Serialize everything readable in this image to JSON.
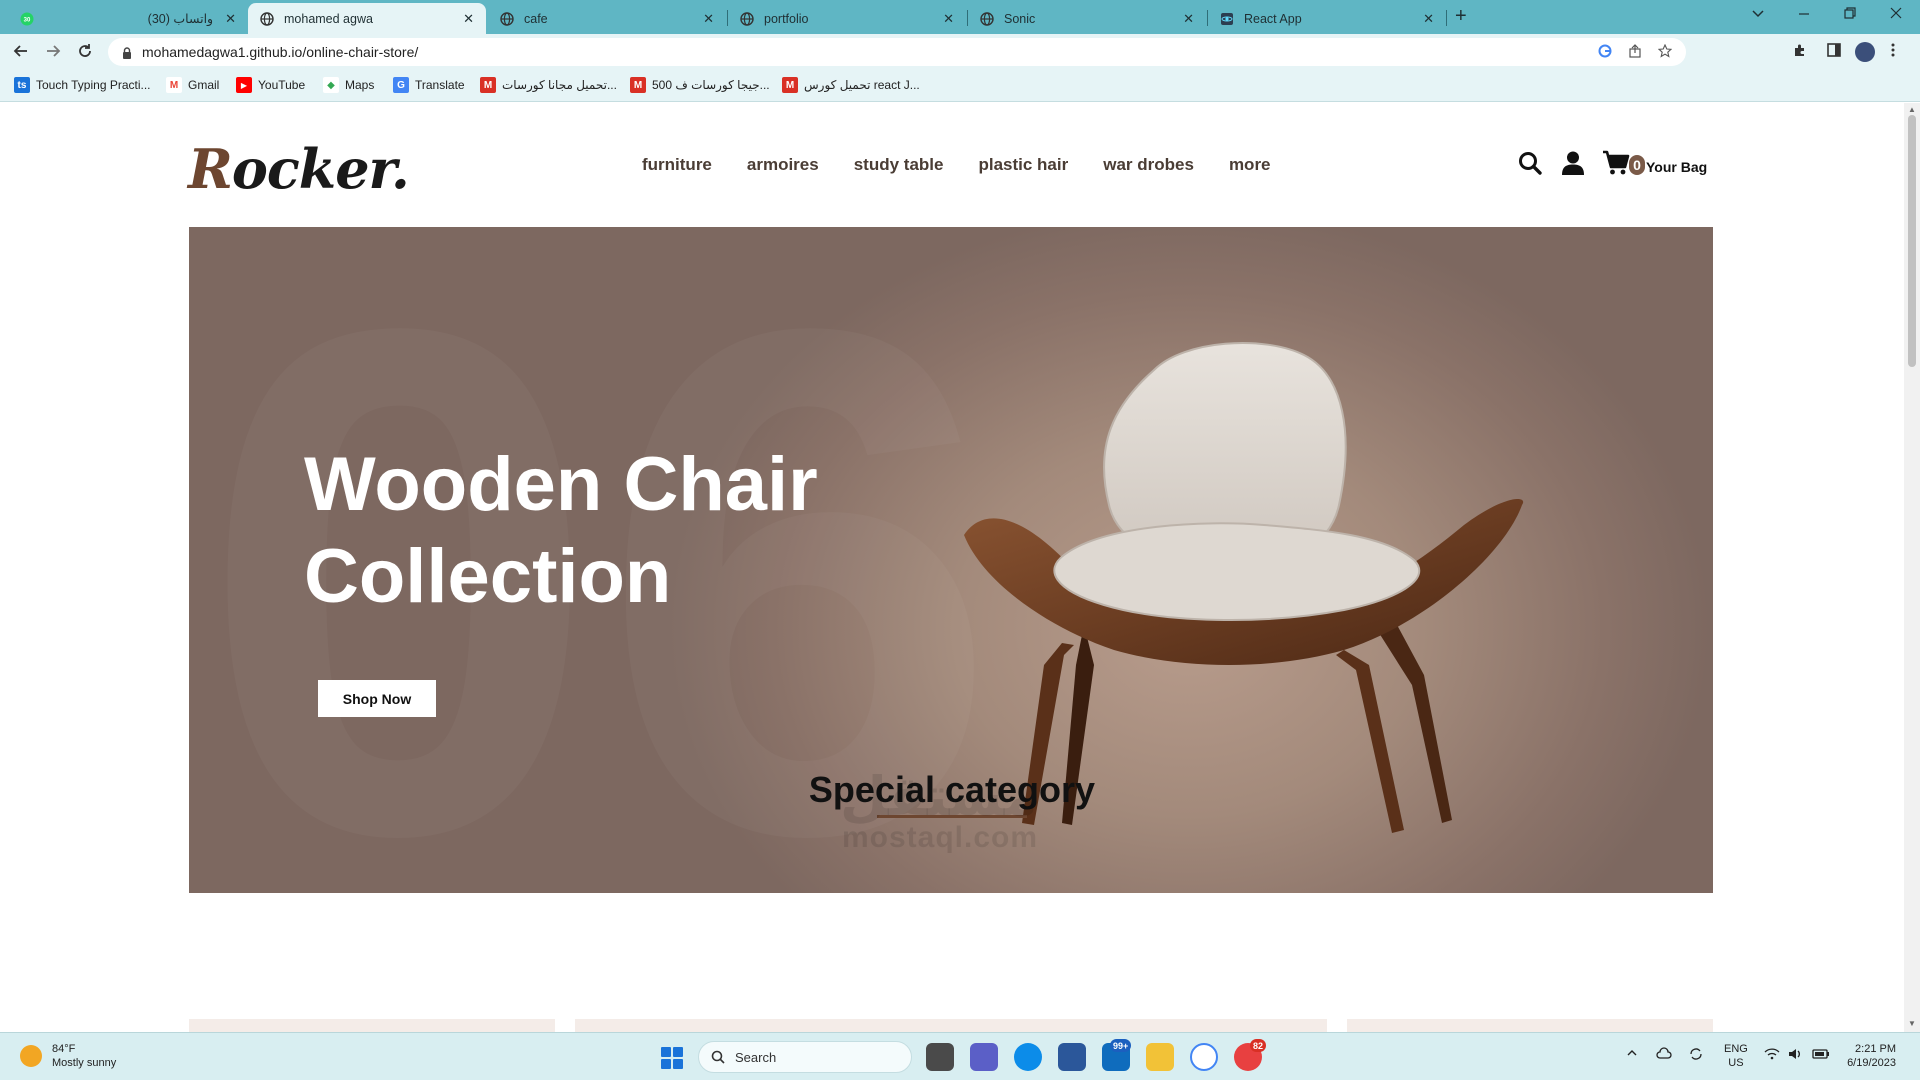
{
  "browser": {
    "tabs": [
      {
        "title": "(30) واتساب",
        "icon": "whatsapp-icon",
        "active": false
      },
      {
        "title": "mohamed agwa",
        "icon": "globe-icon",
        "active": true
      },
      {
        "title": "cafe",
        "icon": "globe-icon",
        "active": false
      },
      {
        "title": "portfolio",
        "icon": "globe-icon",
        "active": false
      },
      {
        "title": "Sonic",
        "icon": "globe-icon",
        "active": false
      },
      {
        "title": "React App",
        "icon": "react-icon",
        "active": false
      }
    ],
    "whatsapp_badge": "30",
    "close_glyph": "✕",
    "new_tab_glyph": "+",
    "url": "mohamedagwa1.github.io/online-chair-store/",
    "bookmarks": [
      {
        "label": "Touch Typing Practi...",
        "icon": "typing-icon",
        "color": "#1a73d9",
        "glyph": "ts"
      },
      {
        "label": "Gmail",
        "icon": "gmail-icon",
        "color": "#ea4335",
        "glyph": "M"
      },
      {
        "label": "YouTube",
        "icon": "youtube-icon",
        "color": "#ff0000",
        "glyph": "▶"
      },
      {
        "label": "Maps",
        "icon": "maps-icon",
        "color": "#34a853",
        "glyph": "◆"
      },
      {
        "label": "Translate",
        "icon": "translate-icon",
        "color": "#4285f4",
        "glyph": "G"
      },
      {
        "label": "تحميل مجانا كورسات...",
        "icon": "m-icon",
        "color": "#d93025",
        "glyph": "M"
      },
      {
        "label": "500 جيجا كورسات ف...",
        "icon": "m-icon",
        "color": "#d93025",
        "glyph": "M"
      },
      {
        "label": "تحميل كورس react J...",
        "icon": "m-icon",
        "color": "#d93025",
        "glyph": "M"
      }
    ]
  },
  "site": {
    "logo": {
      "first": "R",
      "rest": "ocker."
    },
    "nav": [
      "furniture",
      "armoires",
      "study table",
      "plastic hair",
      "war drobes",
      "more"
    ],
    "cart_count": "0",
    "cart_label": "Your Bag",
    "hero": {
      "title": "Wooden Chair Collection",
      "cta": "Shop Now",
      "background_color": "#a38a7b",
      "ghost_text": "06"
    },
    "section_title": "Special category",
    "accent_color": "#6d4630"
  },
  "watermark": {
    "line1": "مستقل",
    "line2": "mostaql.com"
  },
  "taskbar": {
    "weather_temp": "84°F",
    "weather_desc": "Mostly sunny",
    "search_placeholder": "Search",
    "mail_badge": "99+",
    "telegram_badge": "82",
    "lang_line1": "ENG",
    "lang_line2": "US",
    "time": "2:21 PM",
    "date": "6/19/2023"
  }
}
